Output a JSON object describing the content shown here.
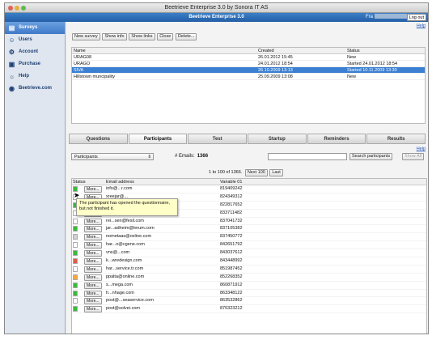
{
  "window": {
    "title": "Beetrieve Enterprise 3.0 by Sonora IT AS"
  },
  "appbar": {
    "title": "Beetrieve Enterprise 3.0",
    "user": "Fra",
    "logout": "Log out"
  },
  "sidebar": {
    "items": [
      {
        "label": "Surveys",
        "icon": "clipboard-icon"
      },
      {
        "label": "Users",
        "icon": "users-icon"
      },
      {
        "label": "Account",
        "icon": "account-icon"
      },
      {
        "label": "Purchase",
        "icon": "cart-icon"
      },
      {
        "label": "Help",
        "icon": "lightbulb-icon"
      },
      {
        "label": "Beetrieve.com",
        "icon": "beetrieve-icon"
      }
    ]
  },
  "help_link": "Help",
  "survey_toolbar": {
    "new": "New survey",
    "info": "Show info",
    "links": "Show links",
    "close": "Close",
    "delete": "Delete..."
  },
  "survey_table": {
    "headers": [
      "Name",
      "Created",
      "Status"
    ],
    "rows": [
      [
        "URAG08",
        "26.01.2012 15:45",
        "New"
      ],
      [
        "URAGO",
        "24.01.2012 18:54",
        "Started 24.01.2012 18:54"
      ],
      [
        "SIVA",
        "26.10.2009 13:13",
        "Started 10.11.2009 13:30"
      ],
      [
        "Hillstown muncipality",
        "25.09.2009 13:08",
        "New"
      ]
    ]
  },
  "tabs": [
    "Questions",
    "Participants",
    "Test",
    "Startup",
    "Reminders",
    "Results"
  ],
  "participants_toolbar": {
    "select": "Participants",
    "emails_label": "# Emails:",
    "emails_count": "1366",
    "search_btn": "Search participants",
    "show_all": "Show All"
  },
  "pager": {
    "text": "1 to 100 of 1366.",
    "next": "Next 100",
    "last": "Last"
  },
  "participants_table": {
    "headers": [
      "Status",
      "Email address",
      "Variable 01"
    ],
    "rows": [
      {
        "status": "#3cb83c",
        "email": "info@...r.com",
        "var": "819409242"
      },
      {
        "status": "#ffffff",
        "email": "xreejar@...",
        "var": "824349312"
      },
      {
        "status": "#3cb83c",
        "email": "",
        "var": "822817652"
      },
      {
        "status": "#ffffff",
        "email": "eri...@sgs.com",
        "var": "833711482"
      },
      {
        "status": "#ffffff",
        "email": "rei...sen@fesil.com",
        "var": "837041732"
      },
      {
        "status": "#3cb83c",
        "email": "jar...adheim@lerum.com",
        "var": "837105382"
      },
      {
        "status": "#d0d0d0",
        "email": "nometaas@oxline.com",
        "var": "837450772"
      },
      {
        "status": "#ffffff",
        "email": "har...n@cgene.com",
        "var": "842651792"
      },
      {
        "status": "#3cb83c",
        "email": "vns@...com",
        "var": "843037612"
      },
      {
        "status": "#e05a4a",
        "email": "k...wredesign.com",
        "var": "843448992"
      },
      {
        "status": "#ffffff",
        "email": "har...service.tr.com",
        "var": "851987452"
      },
      {
        "status": "#f2a93b",
        "email": "ppalta@online.com",
        "var": "852268352"
      },
      {
        "status": "#3cb83c",
        "email": "s...mega.com",
        "var": "860871912"
      },
      {
        "status": "#3cb83c",
        "email": "h...nhage.com",
        "var": "863348122"
      },
      {
        "status": "#ffffff",
        "email": "post@...seaservice.com",
        "var": "863532862"
      },
      {
        "status": "#3cb83c",
        "email": "post@solvei.com",
        "var": "870323212"
      }
    ],
    "more": "More..."
  },
  "tooltip": "The participant has opened the questionnaire, but not finished it."
}
